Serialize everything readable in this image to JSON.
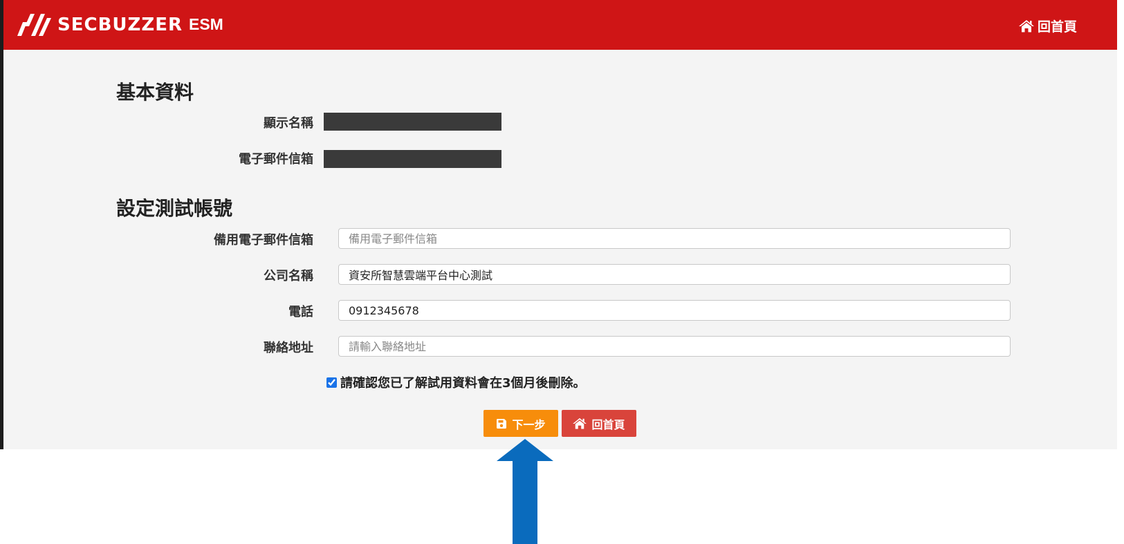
{
  "navbar": {
    "logo_text": "SECBUZZER",
    "brand": "ESM",
    "home_label": "回首頁"
  },
  "basic_info": {
    "title": "基本資料",
    "display_name_label": "顯示名稱",
    "email_label": "電子郵件信箱"
  },
  "trial_account": {
    "title": "設定測試帳號",
    "backup_email": {
      "label": "備用電子郵件信箱",
      "value": "",
      "placeholder": "備用電子郵件信箱"
    },
    "company": {
      "label": "公司名稱",
      "value": "資安所智慧雲端平台中心測試",
      "placeholder": ""
    },
    "phone": {
      "label": "電話",
      "value": "0912345678",
      "placeholder": ""
    },
    "address": {
      "label": "聯絡地址",
      "value": "",
      "placeholder": "請輸入聯絡地址"
    }
  },
  "confirm": {
    "checked": true,
    "text": "請確認您已了解試用資料會在3個月後刪除。"
  },
  "actions": {
    "next_label": "下一步",
    "home_label": "回首頁"
  },
  "colors": {
    "navbar": "#cf1516",
    "next_button": "#f78d0b",
    "home_button": "#d9443b",
    "annotation_arrow": "#0a6bbd"
  },
  "icons": {
    "nav_home": "home-icon",
    "next": "floppy-disk-icon",
    "home": "home-icon",
    "annotation": "arrow-up-icon"
  }
}
